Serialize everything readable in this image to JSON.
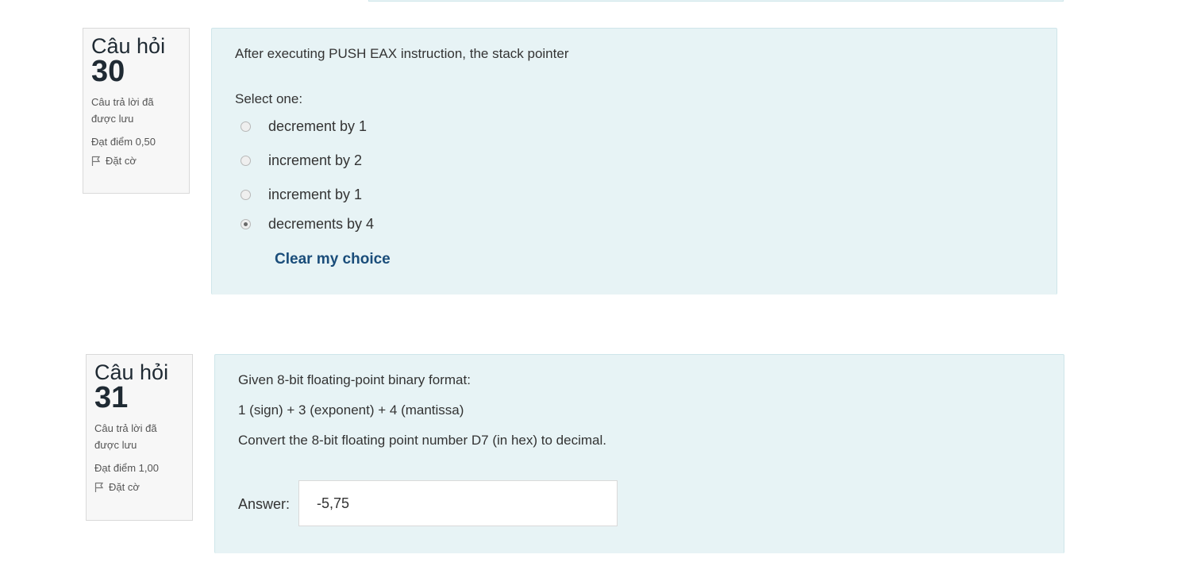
{
  "questions": [
    {
      "label": "Câu hỏi",
      "number": "30",
      "status": "Câu trả lời đã được lưu",
      "points": "Đạt điểm 0,50",
      "flag_label": "Đặt cờ",
      "text": "After executing PUSH EAX instruction, the stack pointer",
      "prompt": "Select one:",
      "options": [
        {
          "label": "decrement by 1",
          "selected": false
        },
        {
          "label": "increment by 2",
          "selected": false
        },
        {
          "label": "increment by 1",
          "selected": false
        },
        {
          "label": "decrements by 4",
          "selected": true
        }
      ],
      "clear_label": "Clear my choice"
    },
    {
      "label": "Câu hỏi",
      "number": "31",
      "status": "Câu trả lời đã được lưu",
      "points": "Đạt điểm 1,00",
      "flag_label": "Đặt cờ",
      "text_lines": [
        "Given 8-bit floating-point binary format:",
        "1 (sign) + 3 (exponent) + 4 (mantissa)",
        "Convert the 8-bit floating point number D7 (in hex) to decimal."
      ],
      "answer_label": "Answer:",
      "answer_value": "-5,75"
    }
  ],
  "colors": {
    "content_bg": "#e7f3f5",
    "link": "#1a4d7a",
    "info_bg": "#f7f7f7"
  }
}
